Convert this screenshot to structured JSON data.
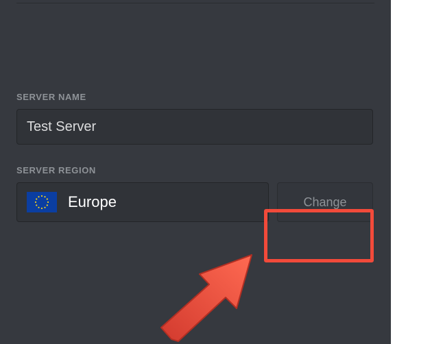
{
  "serverName": {
    "label": "SERVER NAME",
    "value": "Test Server"
  },
  "serverRegion": {
    "label": "SERVER REGION",
    "currentRegion": "Europe",
    "flagIcon": "eu-flag",
    "changeButtonLabel": "Change"
  },
  "colors": {
    "panelBg": "#36393f",
    "inputBg": "#303338",
    "labelText": "#8e9297",
    "annotationRed": "#f24a3a"
  }
}
